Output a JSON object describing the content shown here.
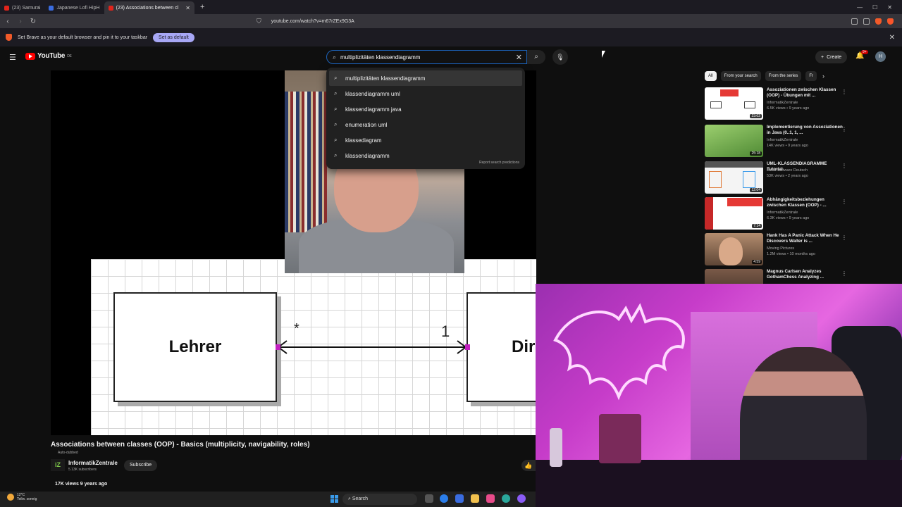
{
  "browser": {
    "tabs": [
      {
        "label": "(23) Samurai"
      },
      {
        "label": "Japanese Lofi HipH"
      },
      {
        "label": "(23) Associations between cl",
        "active": true
      }
    ],
    "url": "youtube.com/watch?v=m67rZEx9G3A",
    "infobar": {
      "message": "Set Brave as your default browser and pin it to your taskbar",
      "button": "Set as default"
    }
  },
  "youtube": {
    "logo_text": "YouTube",
    "logo_region": "DE",
    "search": {
      "value": "multiplizitäten klassendiagramm",
      "suggestions": [
        "multiplizitäten klassendiagramm",
        "klassendiagramm uml",
        "klassendiagramm java",
        "enumeration uml",
        "klassediagram",
        "klassendiagramm"
      ],
      "report": "Report search predictions"
    },
    "create_label": "Create",
    "notif_count": "9+",
    "avatar_letter": "H"
  },
  "video": {
    "slide": {
      "left_class": "Lehrer",
      "right_class": "Dir",
      "left_multiplicity": "*",
      "right_multiplicity": "1"
    },
    "title": "Associations between classes (OOP) - Basics (multiplicity, navigability, roles)",
    "auto_dubbed": "Auto-dubbed",
    "channel": "InformatikZentrale",
    "channel_avatar": "iZ",
    "subscribers": "5.13K subscribers",
    "subscribe_label": "Subscribe",
    "meta": "17K views  9 years ago"
  },
  "sidebar": {
    "chips": [
      "All",
      "From your search",
      "From the series",
      "Fr"
    ],
    "items": [
      {
        "title": "Assoziationen zwischen Klassen (OOP) - Übungen mit ...",
        "channel": "InformatikZentrale",
        "meta": "6.5K views • 9 years ago",
        "duration": "23:02",
        "thumb": "#ffffff"
      },
      {
        "title": "Implementierung von Assoziationen in Java (0..1, 1, ...",
        "channel": "InformatikZentrale",
        "meta": "14K views • 9 years ago",
        "duration": "25:18",
        "thumb": "#6da84d"
      },
      {
        "title": "UML-KLASSENDIAGRAMME Tutorial",
        "channel": "Lucid Software Deutsch",
        "meta": "53K views • 2 years ago",
        "duration": "12:04",
        "thumb": "#f4f4f4"
      },
      {
        "title": "Abhängigkeitsbeziehungen zwischen Klassen (OOP) - ...",
        "channel": "InformatikZentrale",
        "meta": "6.3K views • 9 years ago",
        "duration": "7:14",
        "thumb": "#ffffff"
      },
      {
        "title": "Hank Has A Panic Attack When He Discovers Walter is ...",
        "channel": "Moving Pictures",
        "meta": "1.2M views • 10 months ago",
        "duration": "4:59",
        "thumb": "#8a6a52"
      },
      {
        "title": "Magnus Carlsen Analyzes GothamChess Analyzing ...",
        "channel": "",
        "meta": "",
        "duration": "",
        "thumb": "#6a4a3a"
      }
    ]
  },
  "taskbar": {
    "temperature": "12°C",
    "weather": "Teilw. sonnig",
    "search": "Search"
  },
  "colors": {
    "accent": "#1c62b9",
    "yt_red": "#ff0000",
    "brave_orange": "#f25a29"
  }
}
